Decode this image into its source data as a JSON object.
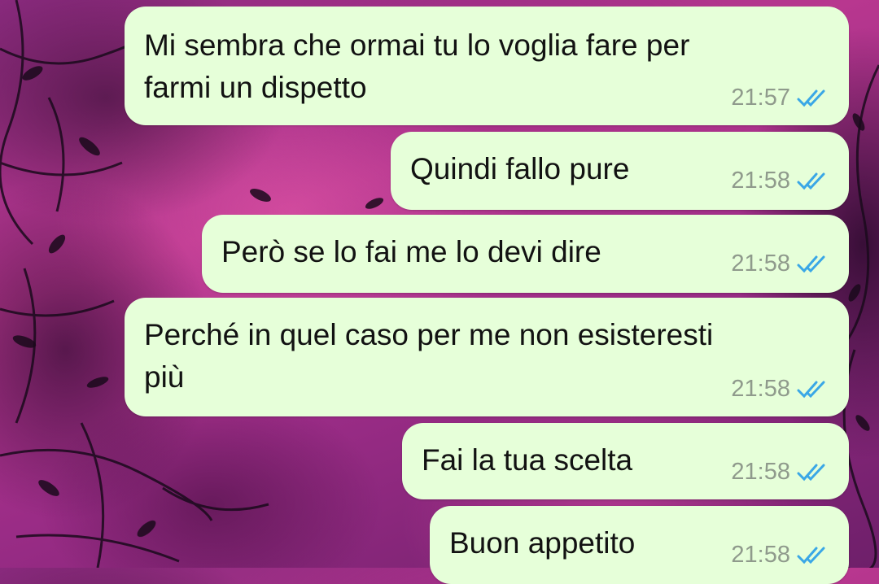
{
  "messages": [
    {
      "text": "Mi sembra che ormai tu lo voglia fare per\nfarmi un dispetto",
      "time": "21:57",
      "status": "read"
    },
    {
      "text": "Quindi fallo pure",
      "time": "21:58",
      "status": "read"
    },
    {
      "text": "Però se lo fai me lo devi dire",
      "time": "21:58",
      "status": "read"
    },
    {
      "text": "Perché in quel caso per me non esisteresti\npiù",
      "time": "21:58",
      "status": "read"
    },
    {
      "text": "Fai la tua scelta",
      "time": "21:58",
      "status": "read"
    },
    {
      "text": "Buon appetito",
      "time": "21:58",
      "status": "read"
    }
  ],
  "colors": {
    "bubble": "#e6ffd9",
    "read_ticks": "#3aa7e6",
    "time": "#8f9a8c"
  },
  "icons": {
    "read_receipt": "double-check-icon"
  }
}
